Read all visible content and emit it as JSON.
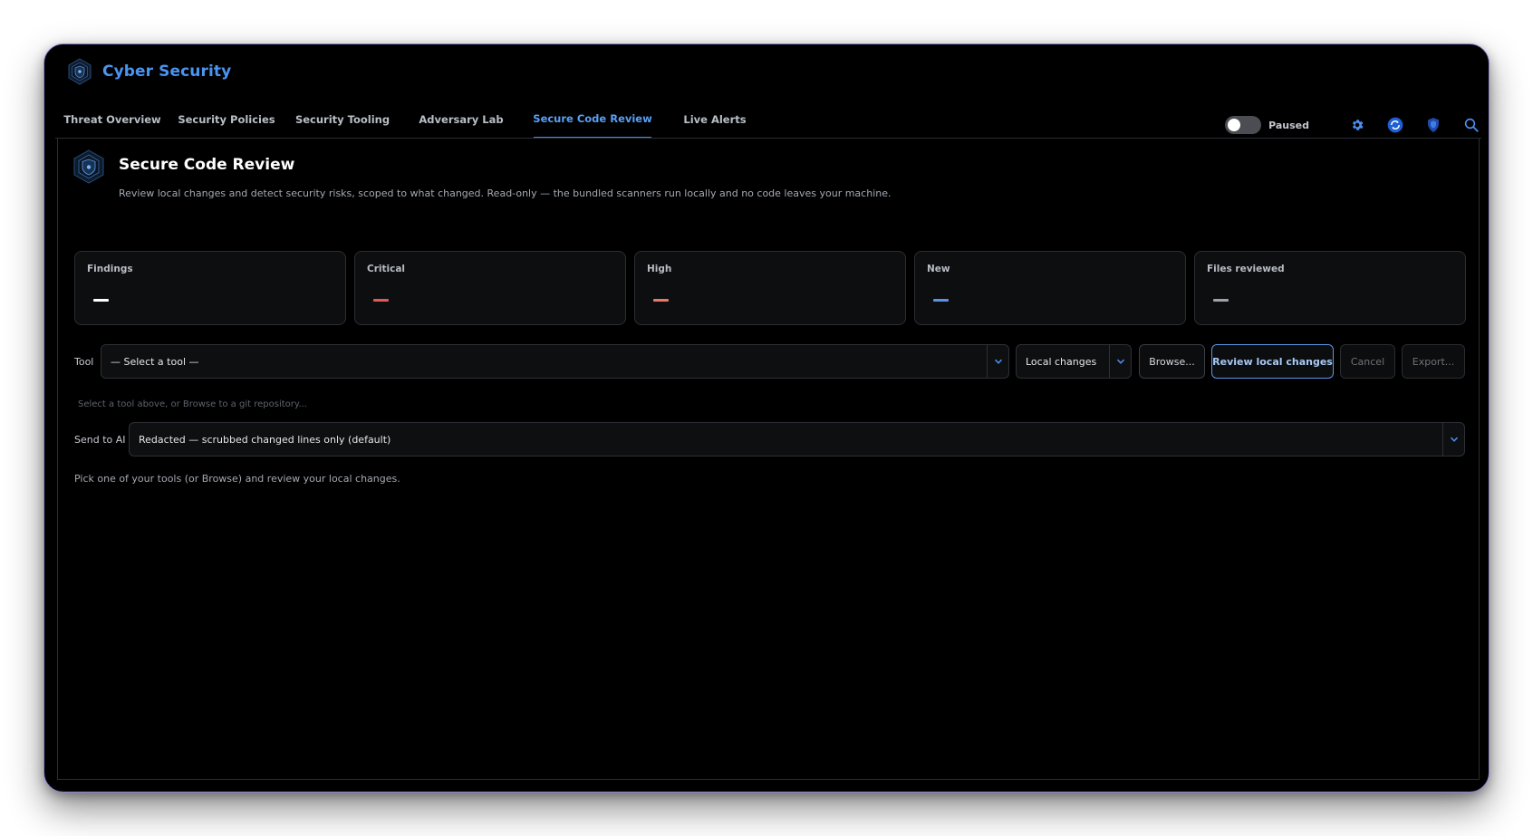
{
  "app": {
    "title": "Cyber Security"
  },
  "tabs": [
    {
      "label": "Threat Overview",
      "active": false
    },
    {
      "label": "Security Policies",
      "active": false
    },
    {
      "label": "Security Tooling",
      "active": false
    },
    {
      "label": "Adversary Lab",
      "active": false
    },
    {
      "label": "Secure Code Review",
      "active": true
    },
    {
      "label": "Live Alerts",
      "active": false
    }
  ],
  "toolbar": {
    "toggle_label": "Paused",
    "toggle_on": false,
    "icons": [
      "gear-icon",
      "refresh-icon",
      "shield-icon",
      "search-icon"
    ]
  },
  "page": {
    "title": "Secure Code Review",
    "subtitle": "Review local changes and detect security risks, scoped to what changed. Read-only — the bundled scanners run locally and no code leaves your machine."
  },
  "metrics": [
    {
      "label": "Findings",
      "value": "—",
      "color": "#ffffff"
    },
    {
      "label": "Critical",
      "value": "—",
      "color": "#e05a55"
    },
    {
      "label": "High",
      "value": "—",
      "color": "#e8776a"
    },
    {
      "label": "New",
      "value": "—",
      "color": "#5d8fe6"
    },
    {
      "label": "Files reviewed",
      "value": "—",
      "color": "#9da2a9"
    }
  ],
  "tool_row": {
    "label": "Tool",
    "tool_select": "— Select a tool —",
    "scope_select": "Local changes",
    "browse": "Browse...",
    "review": "Review local changes",
    "cancel": "Cancel",
    "export": "Export..."
  },
  "hint": "Select a tool above, or Browse to a git repository...",
  "ai_row": {
    "label": "Send to AI",
    "select": "Redacted — scrubbed changed lines only (default)"
  },
  "footer_note": "Pick one of your tools (or Browse) and review your local changes.",
  "colors": {
    "accent": "#3b8cf0",
    "brand": "#4a95f2",
    "window_border": "#8f84d8"
  }
}
